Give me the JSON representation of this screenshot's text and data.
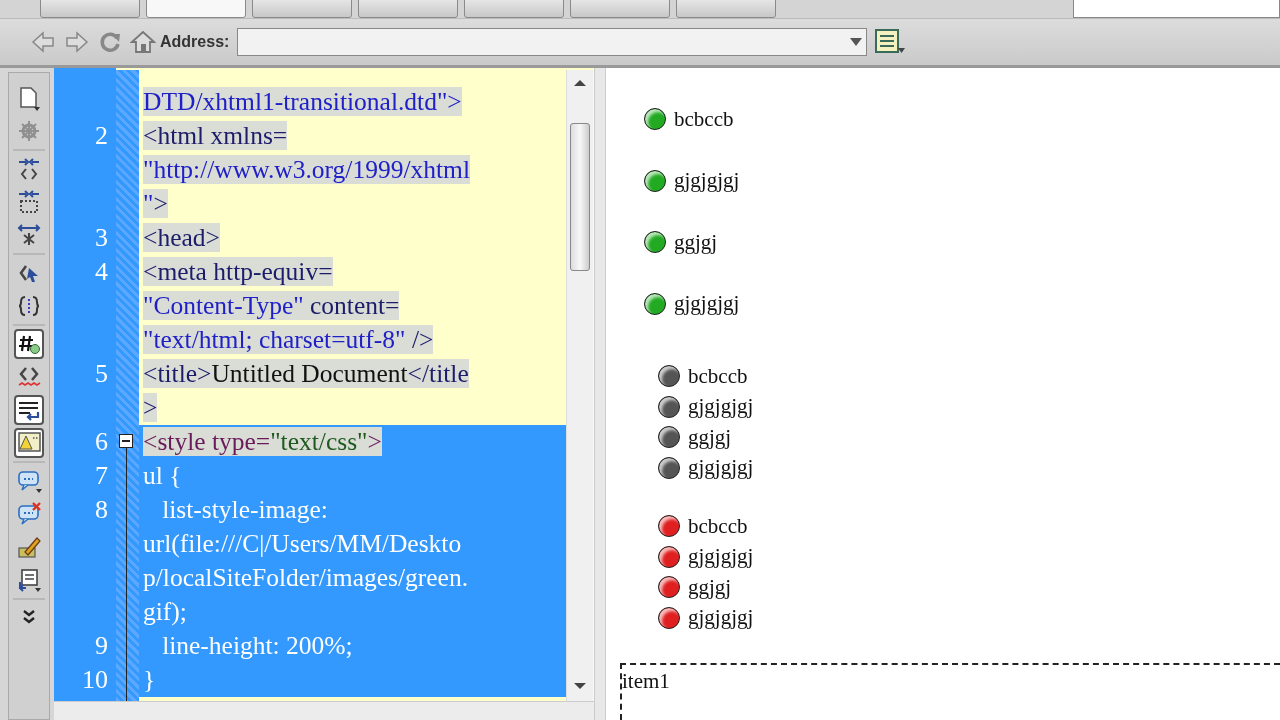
{
  "top_toolbar": {
    "buttons": [
      {
        "selected": false
      },
      {
        "selected": true
      },
      {
        "selected": false
      },
      {
        "selected": false
      },
      {
        "selected": false
      },
      {
        "selected": false
      },
      {
        "selected": false
      }
    ]
  },
  "address_bar": {
    "label": "Address:"
  },
  "code_toolbar": [
    {
      "kind": "document",
      "selected": false,
      "disabled": false
    },
    {
      "kind": "gear",
      "selected": false,
      "disabled": true
    },
    {
      "kind": "collapse-tag",
      "selected": false,
      "disabled": false
    },
    {
      "kind": "collapse-selection",
      "selected": false,
      "disabled": false
    },
    {
      "kind": "expand",
      "selected": false,
      "disabled": false
    },
    {
      "kind": "select-parent",
      "selected": false,
      "disabled": false
    },
    {
      "kind": "braces",
      "selected": false,
      "disabled": false
    },
    {
      "kind": "hash",
      "selected": true,
      "disabled": false
    },
    {
      "kind": "invalid",
      "selected": false,
      "disabled": false
    },
    {
      "kind": "wrap",
      "selected": true,
      "disabled": false
    },
    {
      "kind": "warning",
      "selected": true,
      "disabled": false
    },
    {
      "kind": "comment",
      "selected": false,
      "disabled": false
    },
    {
      "kind": "uncomment",
      "selected": false,
      "disabled": false
    },
    {
      "kind": "pencil",
      "selected": false,
      "disabled": false
    },
    {
      "kind": "snippets",
      "selected": false,
      "disabled": false
    },
    {
      "kind": "more",
      "selected": false,
      "disabled": false
    }
  ],
  "code_lines": [
    {
      "kind": "marked",
      "rows": [
        [
          {
            "t": "DTD/xhtml1-transitional.dtd\"",
            "kind": "value"
          },
          {
            "t": ">",
            "kind": "value"
          }
        ]
      ]
    },
    {
      "number": "2",
      "kind": "marked",
      "rows": [
        [
          {
            "t": "<html xmlns=",
            "kind": "tag"
          }
        ],
        [
          {
            "t": "\"http://www.w3.org/1999/xhtml",
            "kind": "value"
          }
        ],
        [
          {
            "t": "\"",
            "kind": "value"
          },
          {
            "t": ">",
            "kind": "tag"
          }
        ]
      ]
    },
    {
      "number": "3",
      "kind": "marked",
      "rows": [
        [
          {
            "t": "<head>",
            "kind": "tag"
          }
        ]
      ]
    },
    {
      "number": "4",
      "kind": "marked",
      "rows": [
        [
          {
            "t": "<meta http-equiv=",
            "kind": "tag"
          }
        ],
        [
          {
            "t": "\"Content-Type\"",
            "kind": "value"
          },
          {
            "t": " content=",
            "kind": "tag"
          }
        ],
        [
          {
            "t": "\"text/html; charset=utf-8\"",
            "kind": "value"
          },
          {
            "t": " />",
            "kind": "tag"
          }
        ]
      ]
    },
    {
      "number": "5",
      "kind": "marked",
      "rows": [
        [
          {
            "t": "<title>",
            "kind": "tag"
          },
          {
            "t": "Untitled Document",
            "kind": "text"
          },
          {
            "t": "</title",
            "kind": "tag"
          }
        ],
        [
          {
            "t": ">",
            "kind": "tag"
          }
        ]
      ]
    },
    {
      "number": "6",
      "kind": "edge",
      "foldable": true,
      "rows": [
        [
          {
            "t": "<style type=",
            "kind": "style-tag"
          },
          {
            "t": "\"text/css\"",
            "kind": "style-value"
          },
          {
            "t": ">",
            "kind": "style-tag"
          }
        ]
      ]
    },
    {
      "number": "7",
      "kind": "selected",
      "rows": [
        [
          {
            "t": "ul {",
            "kind": "text"
          }
        ]
      ]
    },
    {
      "number": "8",
      "kind": "selected",
      "rows": [
        [
          {
            "t": "   list-style-image:",
            "kind": "text"
          }
        ],
        [
          {
            "t": "url(file:///C|/Users/MM/Deskto",
            "kind": "text"
          }
        ],
        [
          {
            "t": "p/localSiteFolder/images/green.",
            "kind": "text"
          }
        ],
        [
          {
            "t": "gif);",
            "kind": "text"
          }
        ]
      ]
    },
    {
      "number": "9",
      "kind": "selected",
      "rows": [
        [
          {
            "t": "   line-height: 200%;",
            "kind": "text"
          }
        ]
      ]
    },
    {
      "number": "10",
      "kind": "selected",
      "rows": [
        [
          {
            "t": "}",
            "kind": "text"
          }
        ]
      ]
    }
  ],
  "design_view": {
    "lists": [
      {
        "color": "#22aa22",
        "kind": "double",
        "items": [
          "bcbccb",
          "gjgjgjgj",
          "ggjgj",
          "gjgjgjgj"
        ]
      },
      {
        "color": "#555555",
        "kind": "single",
        "items": [
          "bcbccb",
          "gjgjgjgj",
          "ggjgj",
          "gjgjgjgj"
        ]
      },
      {
        "color": "#e02020",
        "kind": "single",
        "items": [
          "bcbccb",
          "gjgjgjgj",
          "ggjgj",
          "gjgjgjgj"
        ]
      }
    ],
    "div_box": {
      "text": "item1"
    }
  }
}
